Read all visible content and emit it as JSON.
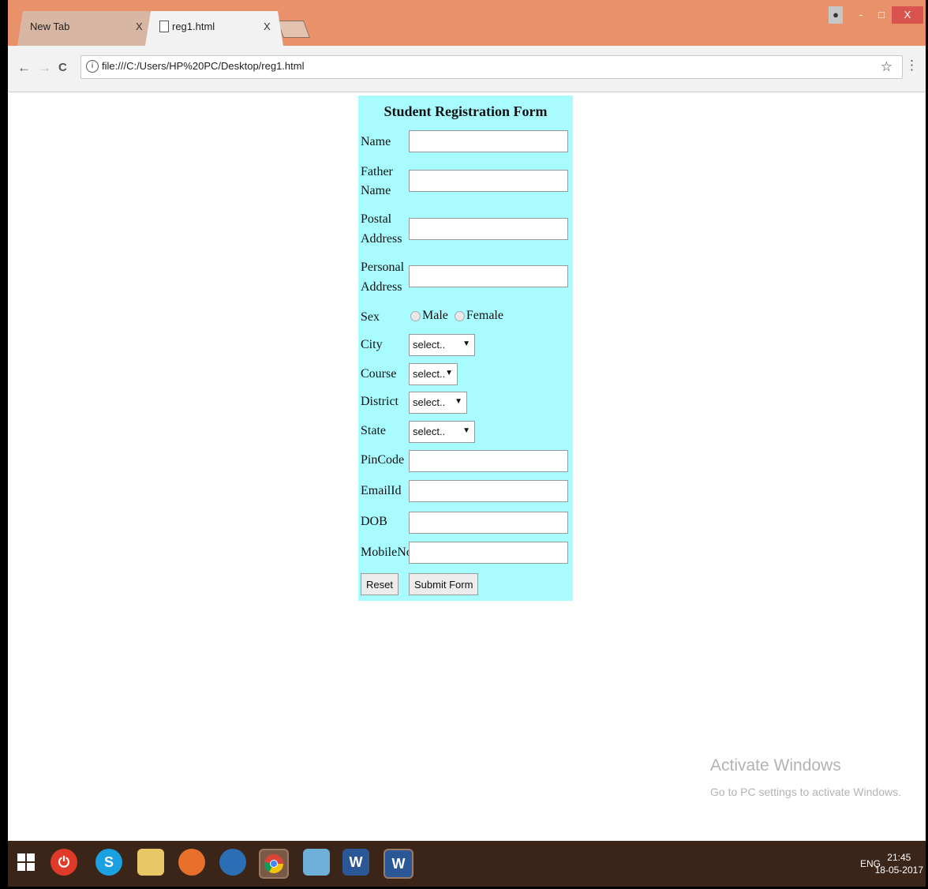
{
  "browser": {
    "tabs": [
      {
        "label": "New Tab",
        "close": "X"
      },
      {
        "label": "reg1.html",
        "close": "X"
      }
    ],
    "window_buttons": {
      "minimize": "-",
      "restore": "□",
      "close": "X"
    },
    "nav": {
      "back": "←",
      "forward": "→",
      "reload": "C",
      "menu": "⋮"
    },
    "url": "file:///C:/Users/HP%20PC/Desktop/reg1.html",
    "info_icon": "i",
    "star": "☆"
  },
  "form": {
    "title": "Student Registration Form",
    "labels": {
      "name": "Name",
      "father_1": "Father",
      "father_2": "Name",
      "postal_1": "Postal",
      "postal_2": "Address",
      "personal_1": "Personal",
      "personal_2": "Address",
      "sex": "Sex",
      "city": "City",
      "course": "Course",
      "district": "District",
      "state": "State",
      "pincode": "PinCode",
      "email": "EmailId",
      "dob": "DOB",
      "mobile": "MobileNo"
    },
    "radio": {
      "male": "Male",
      "female": "Female"
    },
    "selects": {
      "city": "select..",
      "course": "select..",
      "district": "select..",
      "state": "select.."
    },
    "select_arrow": "▼",
    "buttons": {
      "reset": "Reset",
      "submit": "Submit Form"
    }
  },
  "watermark": {
    "line1": "Activate Windows",
    "line2": "Go to PC settings to activate Windows."
  },
  "taskbar": {
    "tray": "ENG",
    "time": "21:45",
    "date": "18-05-2017",
    "icons": [
      "windows-start",
      "power",
      "skype",
      "file-manager",
      "firefox",
      "media",
      "chrome",
      "notes",
      "word",
      "word"
    ]
  }
}
